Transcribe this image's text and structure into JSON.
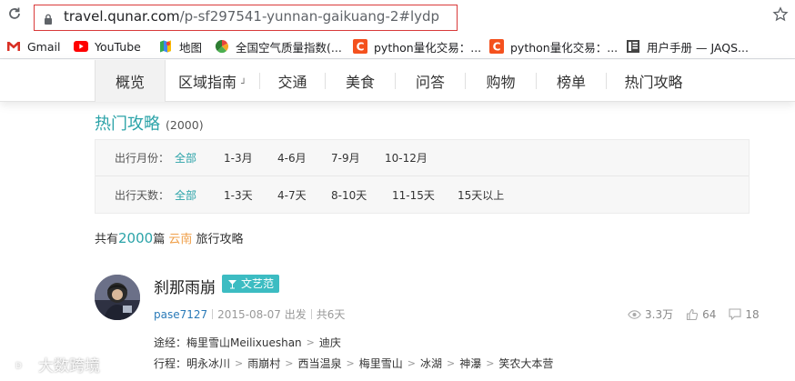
{
  "browser": {
    "url_host": "travel.qunar.com",
    "url_path": "/p-sf297541-yunnan-gaikuang-2#lydp",
    "bookmarks": [
      {
        "label": "Gmail",
        "icon": "gmail-icon"
      },
      {
        "label": "YouTube",
        "icon": "youtube-icon"
      },
      {
        "label": "地图",
        "icon": "maps-icon"
      },
      {
        "label": "全国空气质量指数(...",
        "icon": "aqi-icon"
      },
      {
        "label": "python量化交易：...",
        "icon": "csdn-icon"
      },
      {
        "label": "python量化交易：...",
        "icon": "csdn-icon"
      },
      {
        "label": "用户手册 — JAQS...",
        "icon": "doc-icon"
      }
    ]
  },
  "nav": {
    "items": [
      "概览",
      "区域指南",
      "交通",
      "美食",
      "问答",
      "购物",
      "榜单",
      "热门攻略"
    ],
    "active": "概览"
  },
  "section": {
    "title": "热门攻略",
    "count": "(2000)"
  },
  "filters": {
    "month": {
      "label": "出行月份：",
      "options": [
        "全部",
        "1-3月",
        "4-6月",
        "7-9月",
        "10-12月"
      ],
      "selected": "全部"
    },
    "days": {
      "label": "出行天数：",
      "options": [
        "全部",
        "1-3天",
        "4-7天",
        "8-10天",
        "11-15天",
        "15天以上"
      ],
      "selected": "全部"
    }
  },
  "summary": {
    "prefix": "共有",
    "number": "2000",
    "mid": "篇",
    "location": "云南",
    "suffix": "旅行攻略"
  },
  "article": {
    "title": "刹那雨崩",
    "badge": "文艺范",
    "user": "pase7127",
    "date": "2015-08-07 出发",
    "days": "共6天",
    "views": "3.3万",
    "likes": "64",
    "comments": "18",
    "route_label": "途经：",
    "route": [
      "梅里雪山Meilixueshan",
      "迪庆"
    ],
    "itinerary_label": "行程：",
    "itinerary": [
      "明永冰川",
      "雨崩村",
      "西当温泉",
      "梅里雪山",
      "冰湖",
      "神瀑",
      "笑农大本营"
    ]
  },
  "watermark": "大数跨境",
  "colors": {
    "accent": "#2ba3a8",
    "badge": "#3cbcc2",
    "location": "#f0a04b",
    "user_link": "#2a7ab8",
    "url_highlight_border": "#d93a3a"
  }
}
